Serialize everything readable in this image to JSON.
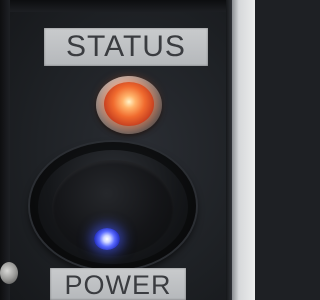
{
  "labels": {
    "status": "STATUS",
    "power": "POWER"
  },
  "indicators": {
    "status_led_color": "#f06a2e",
    "power_led_color": "#5a6bff"
  }
}
